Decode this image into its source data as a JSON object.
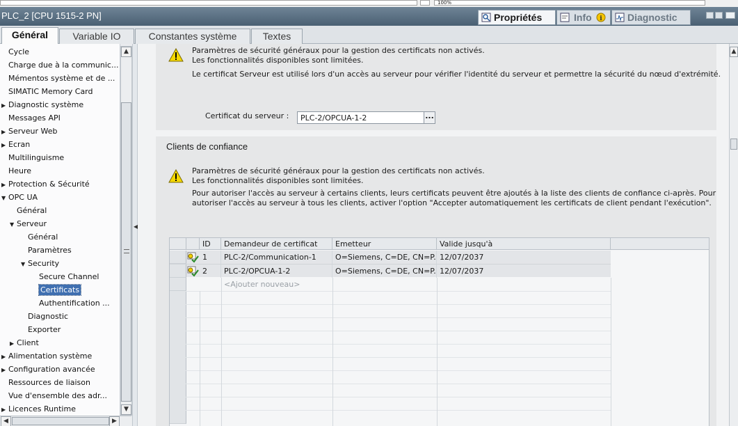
{
  "header": {
    "title": "PLC_2 [CPU 1515-2 PN]",
    "top_zoom": "100%",
    "inspector_tabs": [
      {
        "label": "Propriétés",
        "icon": "properties-icon",
        "active": true
      },
      {
        "label": "Info",
        "icon": "info-icon",
        "active": false
      },
      {
        "label": "Diagnostic",
        "icon": "diagnostic-icon",
        "active": false
      }
    ]
  },
  "tabs": [
    {
      "label": "Général",
      "active": true
    },
    {
      "label": "Variable IO",
      "active": false
    },
    {
      "label": "Constantes système",
      "active": false
    },
    {
      "label": "Textes",
      "active": false
    }
  ],
  "tree": [
    {
      "label": "Cycle",
      "level": 0,
      "arrow": "none"
    },
    {
      "label": "Charge due à la communic...",
      "level": 0,
      "arrow": "none"
    },
    {
      "label": "Mémentos système et de ...",
      "level": 0,
      "arrow": "none"
    },
    {
      "label": "SIMATIC Memory Card",
      "level": 0,
      "arrow": "none"
    },
    {
      "label": "Diagnostic système",
      "level": 0,
      "arrow": "collapsed"
    },
    {
      "label": "Messages API",
      "level": 0,
      "arrow": "none"
    },
    {
      "label": "Serveur Web",
      "level": 0,
      "arrow": "collapsed"
    },
    {
      "label": "Ecran",
      "level": 0,
      "arrow": "collapsed"
    },
    {
      "label": "Multilinguisme",
      "level": 0,
      "arrow": "none"
    },
    {
      "label": "Heure",
      "level": 0,
      "arrow": "none"
    },
    {
      "label": "Protection & Sécurité",
      "level": 0,
      "arrow": "collapsed"
    },
    {
      "label": "OPC UA",
      "level": 0,
      "arrow": "expanded"
    },
    {
      "label": "Général",
      "level": 1,
      "arrow": "none"
    },
    {
      "label": "Serveur",
      "level": 1,
      "arrow": "expanded"
    },
    {
      "label": "Général",
      "level": 2,
      "arrow": "none"
    },
    {
      "label": "Paramètres",
      "level": 2,
      "arrow": "none"
    },
    {
      "label": "Security",
      "level": 2,
      "arrow": "expanded"
    },
    {
      "label": "Secure Channel",
      "level": 3,
      "arrow": "none"
    },
    {
      "label": "Certificats",
      "level": 3,
      "arrow": "none",
      "selected": true
    },
    {
      "label": "Authentification ...",
      "level": 3,
      "arrow": "none"
    },
    {
      "label": "Diagnostic",
      "level": 2,
      "arrow": "none"
    },
    {
      "label": "Exporter",
      "level": 2,
      "arrow": "none"
    },
    {
      "label": "Client",
      "level": 1,
      "arrow": "collapsed"
    },
    {
      "label": "Alimentation système",
      "level": 0,
      "arrow": "collapsed"
    },
    {
      "label": "Configuration avancée",
      "level": 0,
      "arrow": "collapsed"
    },
    {
      "label": "Ressources de liaison",
      "level": 0,
      "arrow": "none"
    },
    {
      "label": "Vue d'ensemble des adr...",
      "level": 0,
      "arrow": "none"
    },
    {
      "label": "Licences Runtime",
      "level": 0,
      "arrow": "collapsed"
    }
  ],
  "server_section": {
    "warning_line1": "Paramètres de sécurité généraux pour la gestion des certificats non activés.",
    "warning_line2": "Les fonctionnalités disponibles sont limitées.",
    "info": "Le certificat Serveur est utilisé lors d'un accès au serveur pour vérifier l'identité du serveur et permettre la sécurité du nœud d'extrémité.",
    "cert_label": "Certificat du serveur :",
    "cert_value": "PLC-2/OPCUA-1-2",
    "browse_label": "..."
  },
  "clients_section": {
    "title": "Clients de confiance",
    "warning_line1": "Paramètres de sécurité généraux pour la gestion des certificats non activés.",
    "warning_line2": "Les fonctionnalités disponibles sont limitées.",
    "info_line1": "Pour autoriser l'accès au serveur à certains clients, leurs certificats peuvent être ajoutés à la liste des clients de confiance ci-après. Pour",
    "info_line2": "autoriser l'accès au serveur à tous les clients, activer l'option \"Accepter automatiquement les certificats de client pendant l'exécution\".",
    "columns": [
      "ID",
      "Demandeur de certificat",
      "Emetteur",
      "Valide jusqu'à"
    ],
    "rows": [
      {
        "id": "1",
        "requester": "PLC-2/Communication-1",
        "issuer": "O=Siemens, C=DE, CN=P...",
        "valid": "12/07/2037"
      },
      {
        "id": "2",
        "requester": "PLC-2/OPCUA-1-2",
        "issuer": "O=Siemens, C=DE, CN=P...",
        "valid": "12/07/2037"
      }
    ],
    "add_new": "<Ajouter nouveau>"
  },
  "colors": {
    "selection": "#3f6fb0",
    "warning_yellow": "#f5d800",
    "titlebar": "#5a6e80"
  }
}
